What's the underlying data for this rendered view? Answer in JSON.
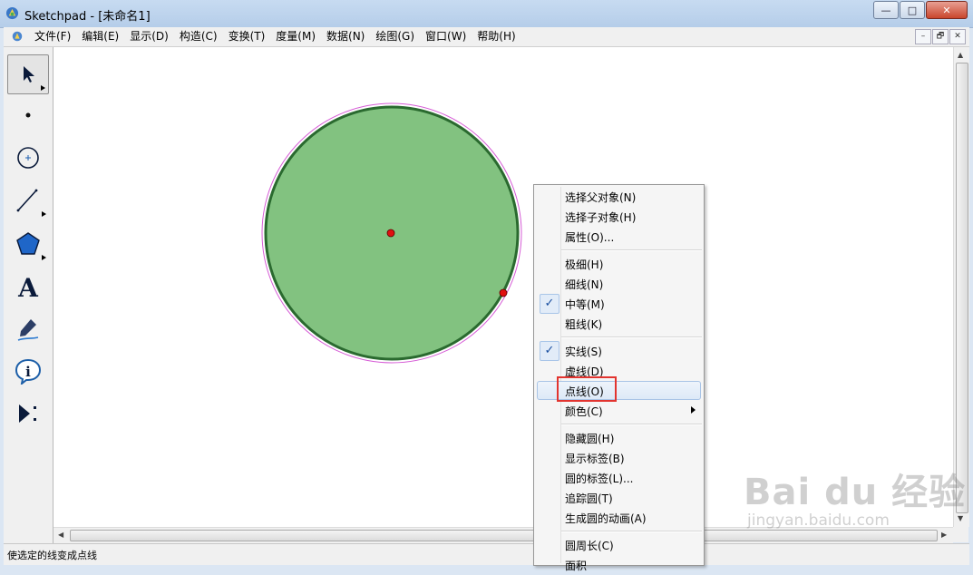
{
  "window": {
    "title": "Sketchpad  - [未命名1]",
    "buttons": {
      "minimize": "—",
      "maximize": "□",
      "close": "✕"
    }
  },
  "menu": {
    "items": [
      "文件(F)",
      "编辑(E)",
      "显示(D)",
      "构造(C)",
      "变换(T)",
      "度量(M)",
      "数据(N)",
      "绘图(G)",
      "窗口(W)",
      "帮助(H)"
    ],
    "mdi_buttons": [
      "–",
      "🗗",
      "✕"
    ]
  },
  "toolbox": {
    "tools": [
      {
        "name": "arrow-select-tool",
        "icon": "arrow-icon",
        "active": true
      },
      {
        "name": "point-tool",
        "icon": "point-icon"
      },
      {
        "name": "compass-tool",
        "icon": "compass-icon"
      },
      {
        "name": "straightedge-tool",
        "icon": "segment-icon"
      },
      {
        "name": "polygon-tool",
        "icon": "polygon-icon"
      },
      {
        "name": "text-tool",
        "icon": "text-icon",
        "label": "A"
      },
      {
        "name": "marker-tool",
        "icon": "marker-icon"
      },
      {
        "name": "information-tool",
        "icon": "info-icon",
        "label": "i"
      },
      {
        "name": "custom-tool",
        "icon": "custom-tool-icon"
      }
    ]
  },
  "sketch": {
    "circle_fill": "#82c280",
    "circle_stroke": "#2a6a2f",
    "highlight_stroke": "#d65cd6",
    "point_color": "#e01010"
  },
  "context_menu": {
    "groups": [
      [
        {
          "label": "选择父对象(N)"
        },
        {
          "label": "选择子对象(H)"
        },
        {
          "label": "属性(O)..."
        }
      ],
      [
        {
          "label": "极细(H)"
        },
        {
          "label": "细线(N)"
        },
        {
          "label": "中等(M)",
          "checked": true
        },
        {
          "label": "粗线(K)"
        }
      ],
      [
        {
          "label": "实线(S)",
          "checked": true
        },
        {
          "label": "虚线(D)"
        },
        {
          "label": "点线(O)",
          "highlighted": true
        },
        {
          "label": "颜色(C)",
          "submenu": true
        }
      ],
      [
        {
          "label": "隐藏圆(H)"
        },
        {
          "label": "显示标签(B)"
        },
        {
          "label": "圆的标签(L)..."
        },
        {
          "label": "追踪圆(T)"
        },
        {
          "label": "生成圆的动画(A)"
        }
      ],
      [
        {
          "label": "圆周长(C)"
        },
        {
          "label": "面积"
        }
      ]
    ],
    "check_glyph": "✓"
  },
  "statusbar": {
    "text": "使选定的线变成点线"
  },
  "watermark": {
    "main": "Bai du 经验",
    "sub": "jingyan.baidu.com"
  }
}
